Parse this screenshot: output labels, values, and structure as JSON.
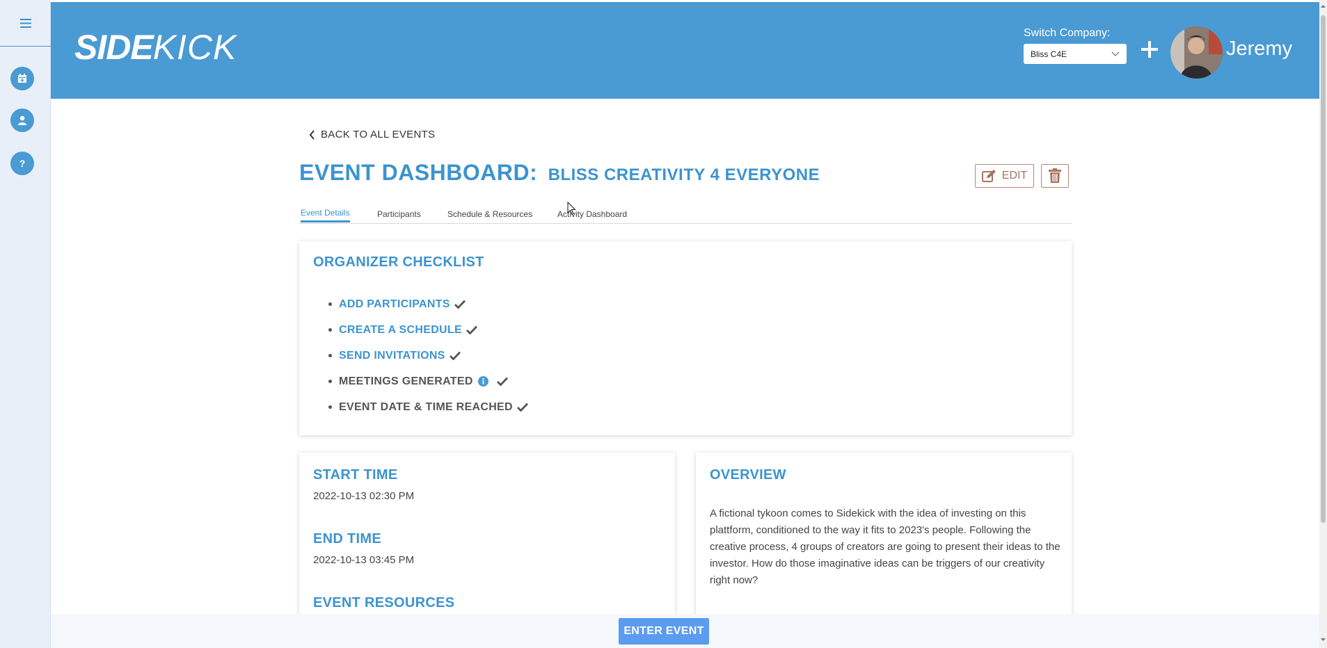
{
  "header": {
    "logo_bold": "SIDE",
    "logo_light": "KICK",
    "switch_label": "Switch Company:",
    "company_selected": "Bliss C4E",
    "user_name": "Jeremy"
  },
  "sidebar": {
    "items": [
      {
        "icon": "menu-icon"
      },
      {
        "icon": "calendar-icon"
      },
      {
        "icon": "user-icon"
      },
      {
        "icon": "help-icon"
      }
    ]
  },
  "page": {
    "back_label": "BACK TO ALL EVENTS",
    "title_prefix": "EVENT DASHBOARD:",
    "event_name": "BLISS CREATIVITY 4 EVERYONE",
    "edit_label": "EDIT"
  },
  "tabs": [
    {
      "label": "Event Details",
      "active": true
    },
    {
      "label": "Participants",
      "active": false
    },
    {
      "label": "Schedule & Resources",
      "active": false
    },
    {
      "label": "Activity Dashboard",
      "active": false
    }
  ],
  "checklist": {
    "title": "ORGANIZER CHECKLIST",
    "items": [
      {
        "label": "ADD PARTICIPANTS",
        "done": true,
        "link": true
      },
      {
        "label": "CREATE A SCHEDULE",
        "done": true,
        "link": true
      },
      {
        "label": "SEND INVITATIONS",
        "done": true,
        "link": true
      },
      {
        "label": "MEETINGS GENERATED",
        "done": true,
        "link": false,
        "info": true
      },
      {
        "label": "EVENT DATE & TIME REACHED",
        "done": true,
        "link": false
      }
    ]
  },
  "details": {
    "start_label": "START TIME",
    "start_value": "2022-10-13 02:30 PM",
    "end_label": "END TIME",
    "end_value": "2022-10-13 03:45 PM",
    "resources_label": "EVENT RESOURCES"
  },
  "overview": {
    "title": "OVERVIEW",
    "text": "A fictional tykoon comes to Sidekick with the idea of investing on this plattform, conditioned to the way it fits to 2023's people. Following the creative process, 4 groups of creators are going to present their ideas to the investor. How do those imaginative ideas can be triggers of our creativity right now?"
  },
  "footer": {
    "enter_label": "ENTER EVENT"
  },
  "colors": {
    "brand": "#4a9ad3",
    "accent_text": "#3c93cf",
    "enter_button": "#5b9bf0",
    "edit_border": "#b98574"
  }
}
